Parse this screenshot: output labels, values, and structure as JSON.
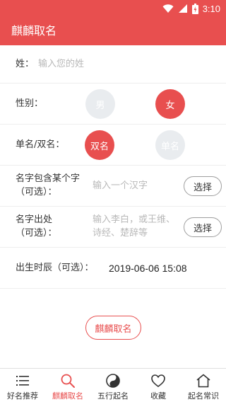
{
  "status_bar": {
    "time": "3:10",
    "icons": [
      "wifi-icon",
      "signal-icon",
      "battery-icon"
    ]
  },
  "app_bar": {
    "title": "麒麟取名"
  },
  "form": {
    "surname": {
      "label": "姓：",
      "placeholder": "输入您的姓"
    },
    "gender": {
      "label": "性别：",
      "options": [
        "男",
        "女"
      ],
      "selected": "女"
    },
    "name_length": {
      "label": "单名/双名：",
      "options": [
        "双名",
        "单名"
      ],
      "selected": "双名"
    },
    "include_char": {
      "label_line1": "名字包含某个字",
      "label_line2": "（可选）：",
      "placeholder": "输入一个汉字",
      "button": "选择"
    },
    "name_source": {
      "label_line1": "名字出处",
      "label_line2": "（可选）：",
      "placeholder_line1": "输入李白，或王维、",
      "placeholder_line2": "诗经、楚辞等",
      "button": "选择"
    },
    "birth_time": {
      "label": "出生时辰（可选）：",
      "value": "2019-06-06 15:08"
    }
  },
  "submit_button": "麒麟取名",
  "bottom_nav": {
    "items": [
      {
        "label": "好名推荐",
        "icon": "list-icon",
        "active": false
      },
      {
        "label": "麒麟取名",
        "icon": "search-icon",
        "active": true
      },
      {
        "label": "五行起名",
        "icon": "yin-yang-icon",
        "active": false
      },
      {
        "label": "收藏",
        "icon": "heart-icon",
        "active": false
      },
      {
        "label": "起名常识",
        "icon": "home-icon",
        "active": false
      }
    ]
  },
  "colors": {
    "accent": "#e84f4f",
    "inactive_circle": "#e9ecef",
    "hint_text": "#b8b8b8"
  }
}
